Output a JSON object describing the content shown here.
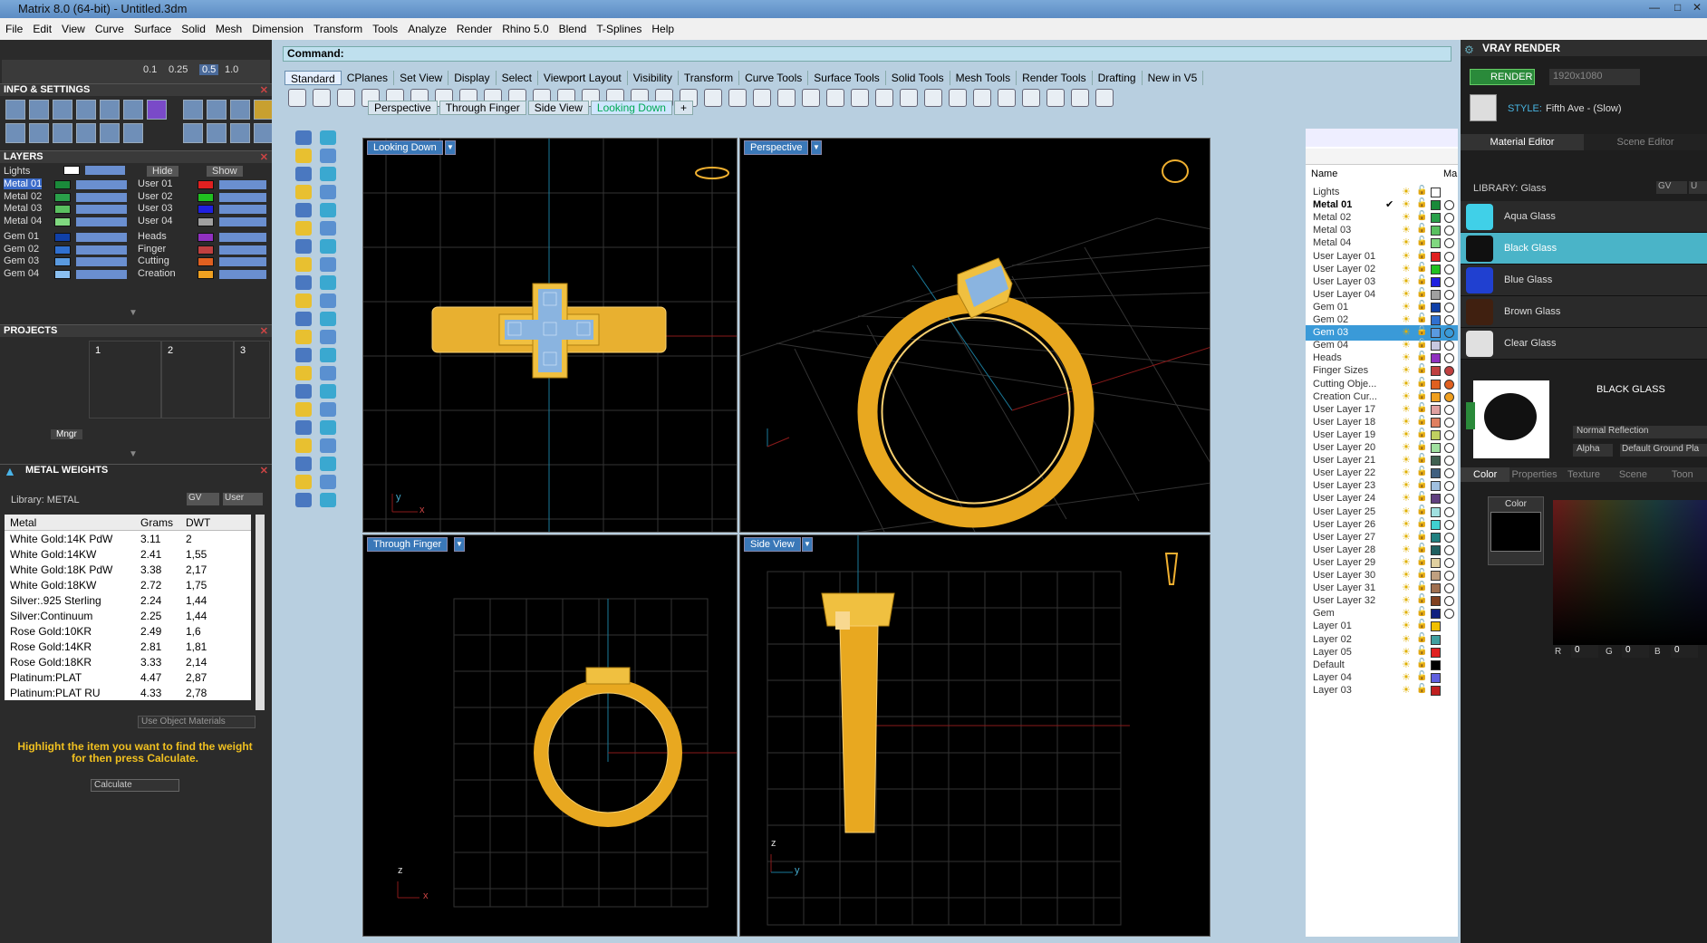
{
  "window": {
    "title": "Matrix 8.0 (64-bit) - Untitled.3dm"
  },
  "menu": [
    "File",
    "Edit",
    "View",
    "Curve",
    "Surface",
    "Solid",
    "Mesh",
    "Dimension",
    "Transform",
    "Tools",
    "Analyze",
    "Render",
    "Rhino 5.0",
    "Blend",
    "T-Splines",
    "Help"
  ],
  "left": {
    "toolbar_values": [
      "0.1",
      "0.25",
      "0.5",
      "1.0"
    ],
    "info_title": "INFO & SETTINGS",
    "layers_title": "LAYERS",
    "layers_lights": "Lights",
    "hide_label": "Hide",
    "show_label": "Show",
    "layers": [
      {
        "name": "Metal 01",
        "color": "#1a8a3a"
      },
      {
        "name": "Metal 02",
        "color": "#2aa04a"
      },
      {
        "name": "Metal 03",
        "color": "#5ac060"
      },
      {
        "name": "Metal 04",
        "color": "#80d880"
      },
      {
        "name": "Gem 01",
        "color": "#1040a8"
      },
      {
        "name": "Gem 02",
        "color": "#3070d0"
      },
      {
        "name": "Gem 03",
        "color": "#5a9ae0"
      },
      {
        "name": "Gem 04",
        "color": "#8abff0"
      }
    ],
    "layers_right": [
      {
        "name": "User 01",
        "color": "#e02020"
      },
      {
        "name": "User 02",
        "color": "#20c020"
      },
      {
        "name": "User 03",
        "color": "#2020e0"
      },
      {
        "name": "User 04",
        "color": "#a0a0a0"
      },
      {
        "name": "Heads",
        "color": "#9030c0"
      },
      {
        "name": "Finger",
        "color": "#c04040"
      },
      {
        "name": "Cutting",
        "color": "#e06020"
      },
      {
        "name": "Creation",
        "color": "#f0a020"
      }
    ],
    "projects_title": "PROJECTS",
    "projects": [
      "1",
      "2",
      "3"
    ],
    "mngr": "Mngr",
    "metal_title": "METAL WEIGHTS",
    "library": "Library: METAL",
    "gv": "GV",
    "user": "User",
    "table_headers": [
      "Metal",
      "Grams",
      "DWT"
    ],
    "metals": [
      [
        "White Gold:14K PdW",
        "3.11",
        "2"
      ],
      [
        "White Gold:14KW",
        "2.41",
        "1,55"
      ],
      [
        "White Gold:18K PdW",
        "3.38",
        "2,17"
      ],
      [
        "White Gold:18KW",
        "2.72",
        "1,75"
      ],
      [
        "Silver:.925 Sterling",
        "2.24",
        "1,44"
      ],
      [
        "Silver:Continuum",
        "2.25",
        "1,44"
      ],
      [
        "Rose Gold:10KR",
        "2.49",
        "1,6"
      ],
      [
        "Rose Gold:14KR",
        "2.81",
        "1,81"
      ],
      [
        "Rose Gold:18KR",
        "3.33",
        "2,14"
      ],
      [
        "Platinum:PLAT",
        "4.47",
        "2,87"
      ],
      [
        "Platinum:PLAT RU",
        "4.33",
        "2,78"
      ]
    ],
    "use_object_materials": "Use Object Materials",
    "hint": "Highlight the item you want to find the weight for then press Calculate.",
    "calculate": "Calculate"
  },
  "center": {
    "command": "Command:",
    "toolbar_tabs": [
      "Standard",
      "CPlanes",
      "Set View",
      "Display",
      "Select",
      "Viewport Layout",
      "Visibility",
      "Transform",
      "Curve Tools",
      "Surface Tools",
      "Solid Tools",
      "Mesh Tools",
      "Render Tools",
      "Drafting",
      "New in V5"
    ],
    "viewport_tabs": [
      "Perspective",
      "Through Finger",
      "Side View",
      "Looking Down"
    ],
    "viewports": [
      "Looking Down",
      "Perspective",
      "Through Finger",
      "Side View"
    ],
    "axis": {
      "x": "x",
      "y": "y",
      "z": "z"
    }
  },
  "layer_panel": {
    "header_name": "Name",
    "header_mat": "Ma",
    "rows": [
      {
        "name": "Lights",
        "color": "#ffffff",
        "circle": false
      },
      {
        "name": "Metal 01",
        "color": "#1a8a3a",
        "current": true
      },
      {
        "name": "Metal 02",
        "color": "#2aa04a"
      },
      {
        "name": "Metal 03",
        "color": "#5ac060"
      },
      {
        "name": "Metal 04",
        "color": "#80d880"
      },
      {
        "name": "User Layer 01",
        "color": "#e02020"
      },
      {
        "name": "User Layer 02",
        "color": "#20c020"
      },
      {
        "name": "User Layer 03",
        "color": "#2020e0"
      },
      {
        "name": "User Layer 04",
        "color": "#a0a0a0"
      },
      {
        "name": "Gem 01",
        "color": "#1040a8"
      },
      {
        "name": "Gem 02",
        "color": "#3070d0"
      },
      {
        "name": "Gem 03",
        "color": "#5a9ae0",
        "selected": true
      },
      {
        "name": "Gem 04",
        "color": "#c8c8e0"
      },
      {
        "name": "Heads",
        "color": "#9030c0"
      },
      {
        "name": "Finger Sizes",
        "color": "#c04040",
        "mat": "#c04040"
      },
      {
        "name": "Cutting Obje...",
        "color": "#e06020",
        "mat": "#e06020"
      },
      {
        "name": "Creation Cur...",
        "color": "#f0a020",
        "mat": "#f0a020"
      },
      {
        "name": "User Layer 17",
        "color": "#e0a0a0"
      },
      {
        "name": "User Layer 18",
        "color": "#e08060"
      },
      {
        "name": "User Layer 19",
        "color": "#c0d060"
      },
      {
        "name": "User Layer 20",
        "color": "#a0e0a0"
      },
      {
        "name": "User Layer 21",
        "color": "#406050"
      },
      {
        "name": "User Layer 22",
        "color": "#406080"
      },
      {
        "name": "User Layer 23",
        "color": "#a0c0e0"
      },
      {
        "name": "User Layer 24",
        "color": "#604080"
      },
      {
        "name": "User Layer 25",
        "color": "#a0e0e0"
      },
      {
        "name": "User Layer 26",
        "color": "#40d0d0"
      },
      {
        "name": "User Layer 27",
        "color": "#208080"
      },
      {
        "name": "User Layer 28",
        "color": "#206060"
      },
      {
        "name": "User Layer 29",
        "color": "#e0d0a0"
      },
      {
        "name": "User Layer 30",
        "color": "#c0a080"
      },
      {
        "name": "User Layer 31",
        "color": "#a07050"
      },
      {
        "name": "User Layer 32",
        "color": "#804020"
      },
      {
        "name": "Gem",
        "color": "#102080"
      },
      {
        "name": "Layer 01",
        "color": "#f0c000",
        "circle": false
      },
      {
        "name": "Layer 02",
        "color": "#40a0a0",
        "circle": false
      },
      {
        "name": "Layer 05",
        "color": "#e02020",
        "circle": false
      },
      {
        "name": "Default",
        "color": "#000000",
        "circle": false
      },
      {
        "name": "Layer 04",
        "color": "#6060e0",
        "circle": false
      },
      {
        "name": "Layer 03",
        "color": "#c02020",
        "circle": false
      }
    ]
  },
  "right": {
    "title": "VRAY RENDER",
    "render_btn": "RENDER",
    "resolution": "1920x1080",
    "style_label": "STYLE:",
    "style_value": "Fifth Ave - (Slow)",
    "tab_material": "Material Editor",
    "tab_scene": "Scene Editor",
    "library": "LIBRARY: Glass",
    "gv": "GV",
    "u": "U",
    "materials": [
      {
        "name": "Aqua Glass",
        "color": "#40d0e8"
      },
      {
        "name": "Black Glass",
        "color": "#101010",
        "selected": true
      },
      {
        "name": "Blue Glass",
        "color": "#2040d0"
      },
      {
        "name": "Brown Glass",
        "color": "#402010"
      },
      {
        "name": "Clear Glass",
        "color": "#e0e0e0"
      }
    ],
    "preview_title": "BLACK GLASS",
    "reflection": "Normal Reflection",
    "alpha": "Alpha",
    "ground": "Default Ground Pla",
    "subtabs": [
      "Color",
      "Properties",
      "Texture",
      "Scene",
      "Toon"
    ],
    "color_label": "Color",
    "rgb": {
      "r_label": "R",
      "r": "0",
      "g_label": "G",
      "g": "0",
      "b_label": "B",
      "b": "0"
    }
  }
}
